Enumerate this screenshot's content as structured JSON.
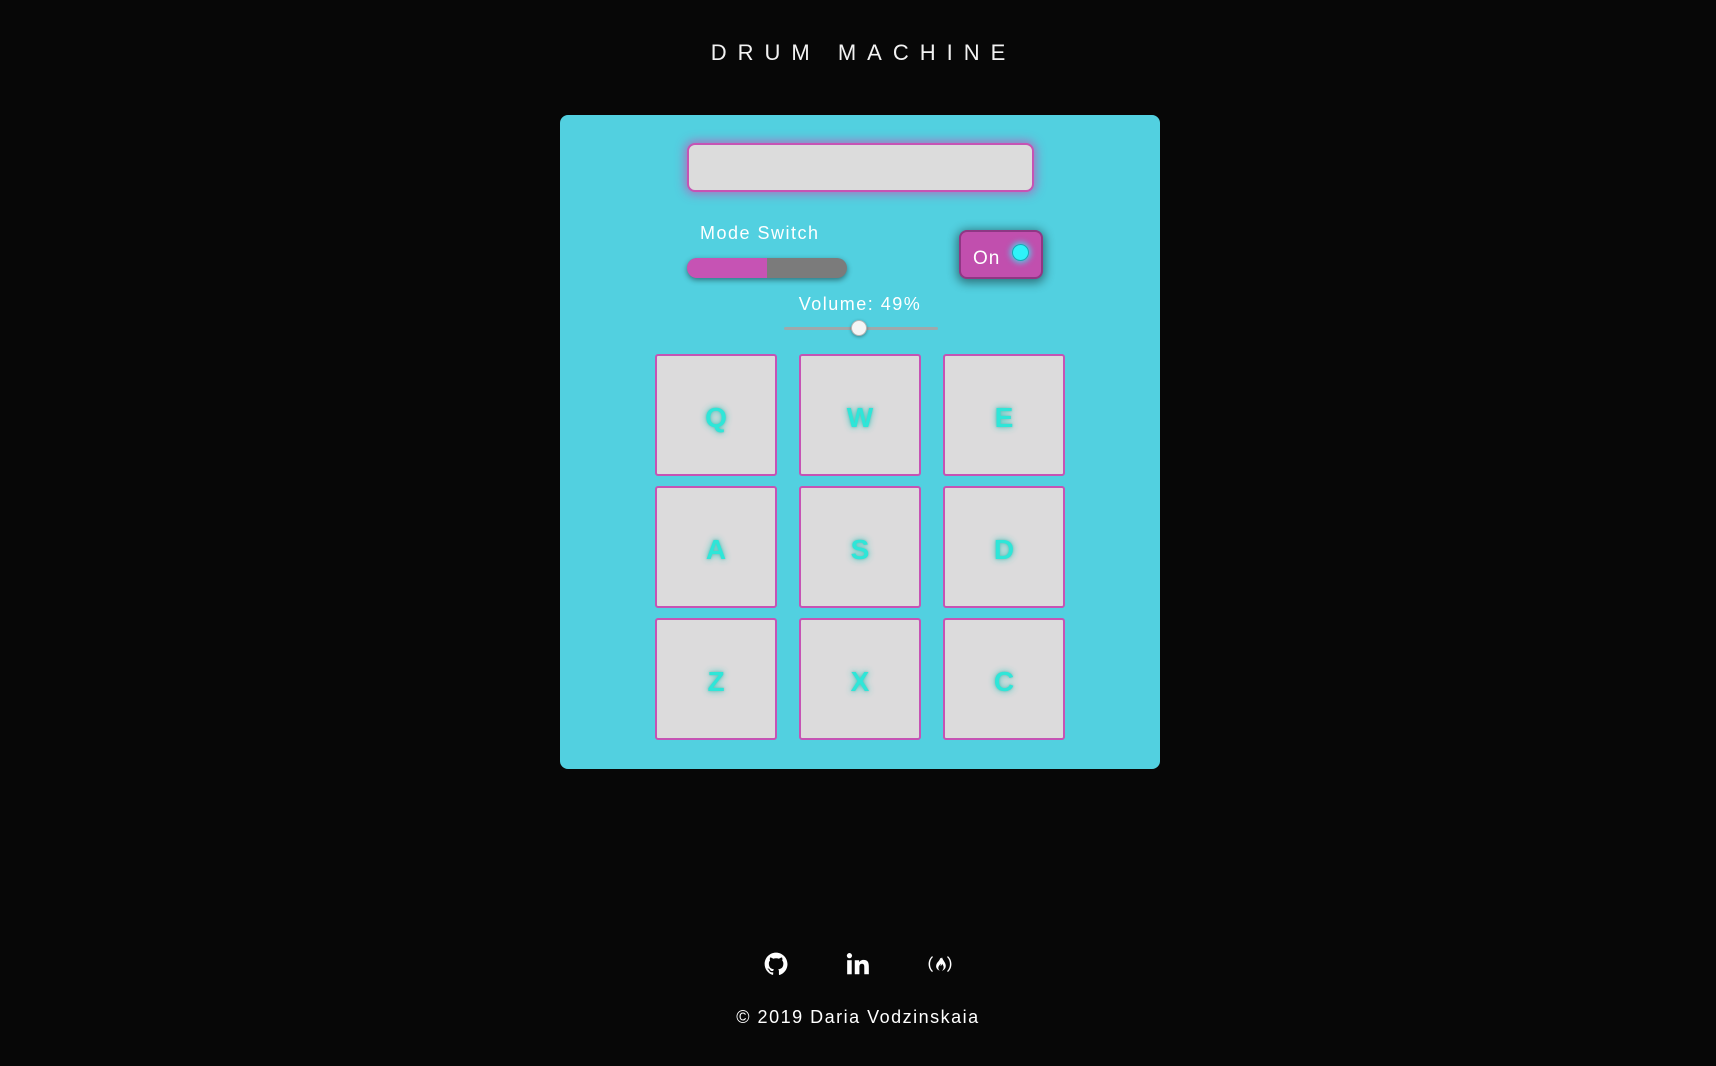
{
  "header": {
    "title": "DRUM MACHINE"
  },
  "display": {
    "text": ""
  },
  "mode": {
    "label": "Mode Switch",
    "level": 0.5
  },
  "power": {
    "label": "On",
    "led_color": "#2ff3f9"
  },
  "volume": {
    "label": "Volume: 49%",
    "value": 49
  },
  "pads": [
    {
      "key": "Q"
    },
    {
      "key": "W"
    },
    {
      "key": "E"
    },
    {
      "key": "A"
    },
    {
      "key": "S"
    },
    {
      "key": "D"
    },
    {
      "key": "Z"
    },
    {
      "key": "X"
    },
    {
      "key": "C"
    }
  ],
  "footer": {
    "links": [
      {
        "name": "github",
        "icon": "github-icon"
      },
      {
        "name": "linkedin",
        "icon": "linkedin-icon"
      },
      {
        "name": "freecodecamp",
        "icon": "freecodecamp-icon"
      }
    ],
    "copyright": "© 2019 Daria Vodzinskaia"
  },
  "colors": {
    "background": "#070707",
    "panel": "#52d0e0",
    "accent": "#c653b4",
    "pad": "#dcdbdc",
    "pad_text": "#2ee6d8"
  }
}
